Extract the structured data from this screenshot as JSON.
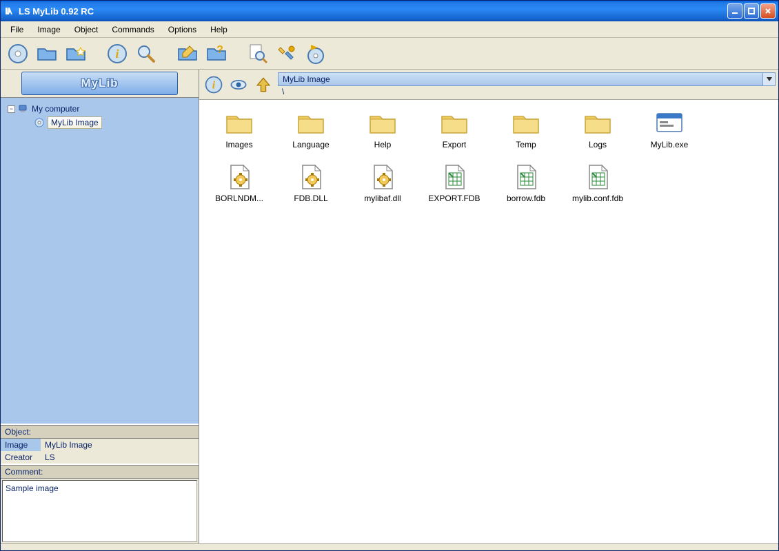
{
  "title": "LS MyLib 0.92 RC",
  "menu": [
    "File",
    "Image",
    "Object",
    "Commands",
    "Options",
    "Help"
  ],
  "toolbar": [
    {
      "name": "new-disc",
      "kind": "disc"
    },
    {
      "name": "open-folder",
      "kind": "folder-blue"
    },
    {
      "name": "folder-star",
      "kind": "folder-blue-star"
    },
    {
      "sep": true
    },
    {
      "name": "info-disc",
      "kind": "disc-info"
    },
    {
      "name": "search",
      "kind": "magnifier"
    },
    {
      "sep": true
    },
    {
      "name": "edit-folder",
      "kind": "folder-edit"
    },
    {
      "name": "help-folder",
      "kind": "folder-help"
    },
    {
      "sep": true
    },
    {
      "name": "find",
      "kind": "magnifier-page"
    },
    {
      "name": "tools",
      "kind": "tools"
    },
    {
      "name": "write-disc",
      "kind": "disc-write"
    }
  ],
  "brand": "MyLib",
  "tree": {
    "root": "My computer",
    "child": "MyLib Image"
  },
  "info": {
    "head": "Object:",
    "rows": [
      {
        "key": "Image",
        "val": "MyLib Image",
        "selKey": true
      },
      {
        "key": "Creator",
        "val": "LS"
      }
    ]
  },
  "comment": {
    "head": "Comment:",
    "text": "Sample image"
  },
  "rightTools": [
    {
      "name": "info-small",
      "kind": "disc-info"
    },
    {
      "name": "view-small",
      "kind": "eye"
    },
    {
      "name": "up-small",
      "kind": "up-arrow"
    }
  ],
  "address": "MyLib Image",
  "path": "\\",
  "files": [
    {
      "name": "Images",
      "type": "folder"
    },
    {
      "name": "Language",
      "type": "folder"
    },
    {
      "name": "Help",
      "type": "folder"
    },
    {
      "name": "Export",
      "type": "folder"
    },
    {
      "name": "Temp",
      "type": "folder"
    },
    {
      "name": "Logs",
      "type": "folder"
    },
    {
      "name": "MyLib.exe",
      "type": "exe"
    },
    {
      "name": "BORLNDM...",
      "type": "dll"
    },
    {
      "name": "FDB.DLL",
      "type": "dll"
    },
    {
      "name": "mylibaf.dll",
      "type": "dll"
    },
    {
      "name": "EXPORT.FDB",
      "type": "fdb"
    },
    {
      "name": "borrow.fdb",
      "type": "fdb"
    },
    {
      "name": "mylib.conf.fdb",
      "type": "fdb"
    }
  ]
}
